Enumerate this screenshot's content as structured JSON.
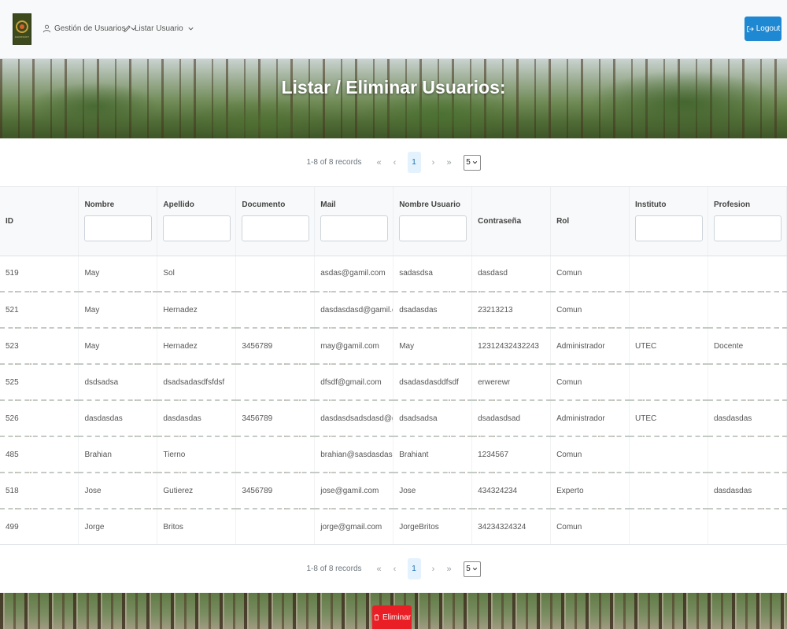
{
  "navbar": {
    "logo_text": "AGROSOFT",
    "menu": [
      {
        "label": "Gestión de Usuarios",
        "icon": "user-icon"
      },
      {
        "label": "Listar Usuario",
        "icon": "pencil-icon"
      }
    ],
    "logout_label": "Logout"
  },
  "hero": {
    "title": "Listar / Eliminar Usuarios:"
  },
  "paginator": {
    "report": "1-8 of 8 records",
    "current_page": "1",
    "rows_per_page": "5",
    "first": "«",
    "prev": "‹",
    "next": "›",
    "last": "»"
  },
  "table": {
    "columns": [
      "ID",
      "Nombre",
      "Apellido",
      "Documento",
      "Mail",
      "Nombre Usuario",
      "Contraseña",
      "Rol",
      "Instituto",
      "Profesion"
    ],
    "rows": [
      [
        "519",
        "May",
        "Sol",
        "",
        "asdas@gamil.com",
        "sadasdsa",
        "dasdasd",
        "Comun",
        "",
        ""
      ],
      [
        "521",
        "May",
        "Hernadez",
        "",
        "dasdasdasd@gamil.com",
        "dsadasdas",
        "23213213",
        "Comun",
        "",
        ""
      ],
      [
        "523",
        "May",
        "Hernadez",
        "3456789",
        "may@gamil.com",
        "May",
        "12312432432243",
        "Administrador",
        "UTEC",
        "Docente"
      ],
      [
        "525",
        "dsdsadsa",
        "dsadsadasdfsfdsf",
        "",
        "dfsdf@gmail.com",
        "dsadasdasddfsdf",
        "erwerewr",
        "Comun",
        "",
        ""
      ],
      [
        "526",
        "dasdasdas",
        "dasdasdas",
        "3456789",
        "dasdasdsadsdasd@gamil.co",
        "dsadsadsa",
        "dsadasdsad",
        "Administrador",
        "UTEC",
        "dasdasdas"
      ],
      [
        "485",
        "Brahian",
        "Tierno",
        "",
        "brahian@sasdasdasd.com",
        "Brahiant",
        "1234567",
        "Comun",
        "",
        ""
      ],
      [
        "518",
        "Jose",
        "Gutierez",
        "3456789",
        "jose@gamil.com",
        "Jose",
        "434324234",
        "Experto",
        "",
        "dasdasdas"
      ],
      [
        "499",
        "Jorge",
        "Britos",
        "",
        "jorge@gmail.com",
        "JorgeBritos",
        "34234324324",
        "Comun",
        "",
        ""
      ]
    ]
  },
  "delete_label": "Eliminar",
  "colors": {
    "primary": "#1e88d2",
    "danger": "#ea1f25",
    "header_bg": "#f8f9fa"
  }
}
